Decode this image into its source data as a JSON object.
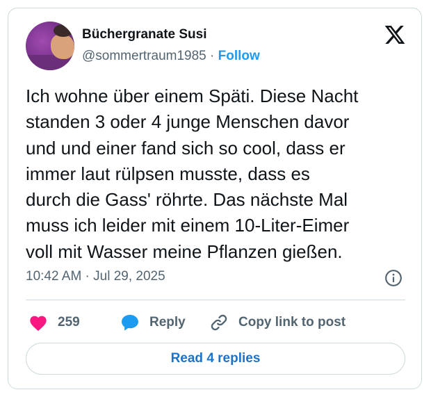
{
  "author": {
    "name": "Büchergranate Susi",
    "handle": "@sommertraum1985",
    "separator": "·",
    "follow_label": "Follow"
  },
  "tweet": {
    "lines": [
      "Ich wohne über einem Späti. Diese Nacht",
      "standen 3 oder 4 junge Menschen davor",
      "und und einer fand sich so cool, dass er",
      "immer laut rülpsen musste, dass es",
      "durch die Gass' röhrte. Das nächste Mal",
      "muss ich leider mit einem 10-Liter-Eimer",
      "voll mit Wasser meine Pflanzen gießen."
    ],
    "timestamp": "10:42 AM · Jul 29, 2025"
  },
  "actions": {
    "like_count": "259",
    "reply_label": "Reply",
    "copy_label": "Copy link to post"
  },
  "read_replies_label": "Read 4 replies",
  "icons": {
    "brand": "x-logo-icon",
    "info": "info-icon",
    "like": "heart-icon",
    "reply": "speech-bubble-icon",
    "copy": "link-icon"
  },
  "colors": {
    "accent": "#1d9bf0",
    "read_button_text": "#1d73c8",
    "heart": "#f91880",
    "text": "#0f1419",
    "muted": "#536471",
    "border": "#cfd9de"
  }
}
